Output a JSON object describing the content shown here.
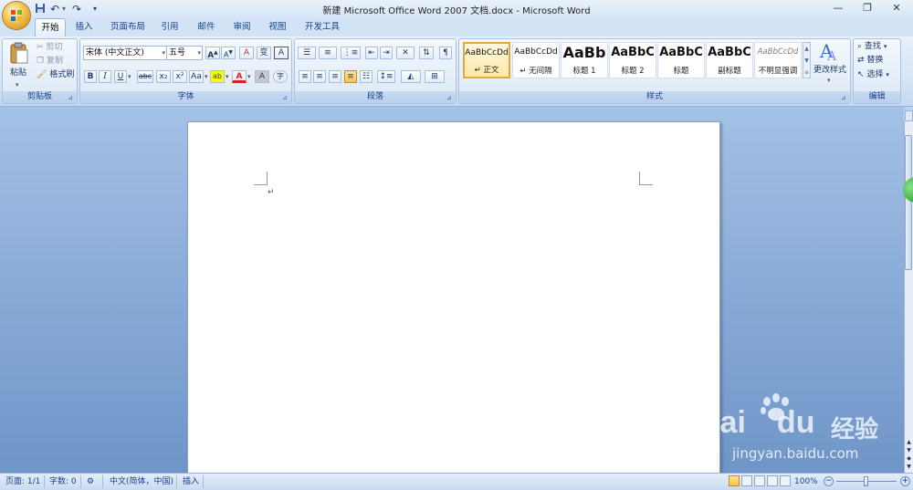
{
  "window": {
    "title": "新建 Microsoft Office Word 2007 文档.docx - Microsoft Word",
    "minimize": "—",
    "restore": "❐",
    "close": "✕"
  },
  "quick_access": {
    "save_icon": "save-icon",
    "undo": "↶",
    "redo": "↷",
    "customize": "▾"
  },
  "tabs": [
    {
      "label": "开始",
      "active": true
    },
    {
      "label": "插入"
    },
    {
      "label": "页面布局"
    },
    {
      "label": "引用"
    },
    {
      "label": "邮件"
    },
    {
      "label": "审阅"
    },
    {
      "label": "视图"
    },
    {
      "label": "开发工具"
    }
  ],
  "clipboard": {
    "group_label": "剪贴板",
    "paste": "粘贴",
    "cut": "剪切",
    "copy": "复制",
    "format_painter": "格式刷"
  },
  "font": {
    "group_label": "字体",
    "font_name": "宋体 (中文正文)",
    "font_size": "五号",
    "grow": "A",
    "shrink": "A",
    "clear": "A",
    "phonetic": "变",
    "border_char": "A",
    "bold": "B",
    "italic": "I",
    "underline": "U",
    "strike": "abc",
    "subscript": "x₂",
    "superscript": "x²",
    "change_case": "Aa",
    "highlight": "ab",
    "font_color": "A",
    "shading": "A",
    "enclose": "字"
  },
  "paragraph": {
    "group_label": "段落"
  },
  "styles": {
    "group_label": "样式",
    "items": [
      {
        "sample": "AaBbCcDd",
        "name": "↵ 正文"
      },
      {
        "sample": "AaBbCcDd",
        "name": "↵ 无间隔"
      },
      {
        "sample": "AaBb",
        "name": "标题 1"
      },
      {
        "sample": "AaBbC",
        "name": "标题 2"
      },
      {
        "sample": "AaBbC",
        "name": "标题"
      },
      {
        "sample": "AaBbC",
        "name": "副标题"
      },
      {
        "sample": "AaBbCcDd",
        "name": "不明显强调"
      }
    ],
    "change_styles": "更改样式"
  },
  "editing": {
    "group_label": "编辑",
    "find": "查找",
    "replace": "替换",
    "select": "选择"
  },
  "document": {
    "paragraph_mark": "↵"
  },
  "statusbar": {
    "page": "页面: 1/1",
    "words": "字数: 0",
    "language": "中文(简体，中国)",
    "mode": "插入",
    "zoom": "100%",
    "zoom_minus": "−",
    "zoom_plus": "+"
  },
  "watermark": {
    "brand": "Bai",
    "brand2": "du",
    "cn": "经验",
    "url": "jingyan.baidu.com"
  },
  "colors": {
    "accent": "#15428b",
    "highlight_yellow": "#ffff00",
    "font_red": "#e02020",
    "selected_style_border": "#e5a83c"
  }
}
